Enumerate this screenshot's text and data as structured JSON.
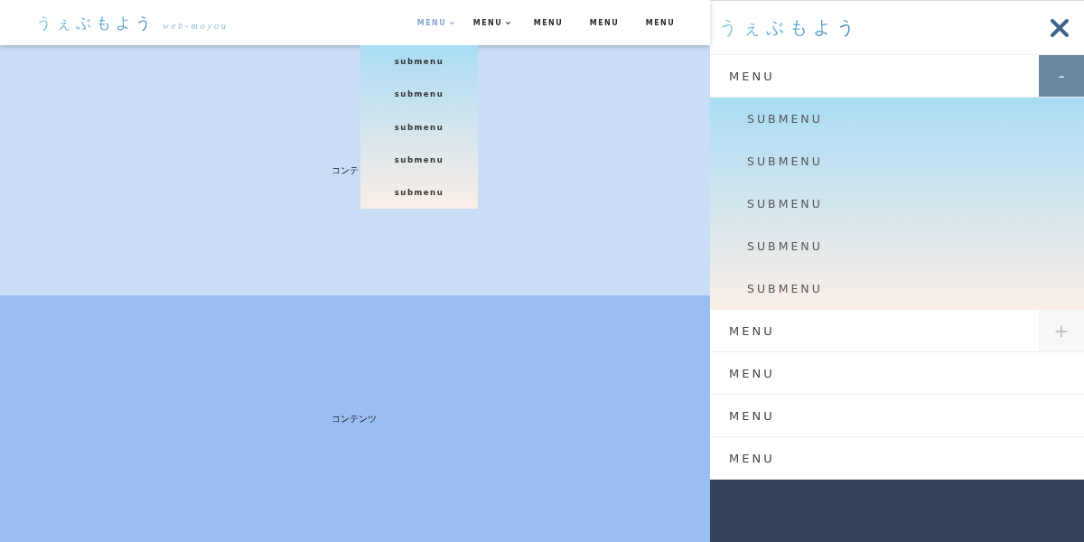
{
  "header": {
    "logo": "うぇぶもよう",
    "logo_sub": "web-moyou",
    "nav": [
      {
        "label": "MENU",
        "selected": true,
        "has_dropdown": true
      },
      {
        "label": "MENU",
        "selected": false,
        "has_dropdown": true
      },
      {
        "label": "MENU",
        "selected": false,
        "has_dropdown": false
      },
      {
        "label": "MENU",
        "selected": false,
        "has_dropdown": false
      },
      {
        "label": "MENU",
        "selected": false,
        "has_dropdown": false
      }
    ],
    "dropdown": [
      "submenu",
      "submenu",
      "submenu",
      "submenu",
      "submenu"
    ]
  },
  "sections": [
    {
      "text": "コンテ"
    },
    {
      "text": "コンテンツ"
    }
  ],
  "drawer": {
    "logo": "うぇぶもよう",
    "items": [
      {
        "label": "MENU",
        "toggle": "-",
        "expanded": true,
        "children": [
          {
            "label": "SUBMENU"
          },
          {
            "label": "SUBMENU"
          },
          {
            "label": "SUBMENU"
          },
          {
            "label": "SUBMENU"
          },
          {
            "label": "SUBMENU"
          }
        ]
      },
      {
        "label": "MENU",
        "toggle": "+",
        "expanded": false
      },
      {
        "label": "MENU"
      },
      {
        "label": "MENU"
      },
      {
        "label": "MENU"
      }
    ]
  }
}
